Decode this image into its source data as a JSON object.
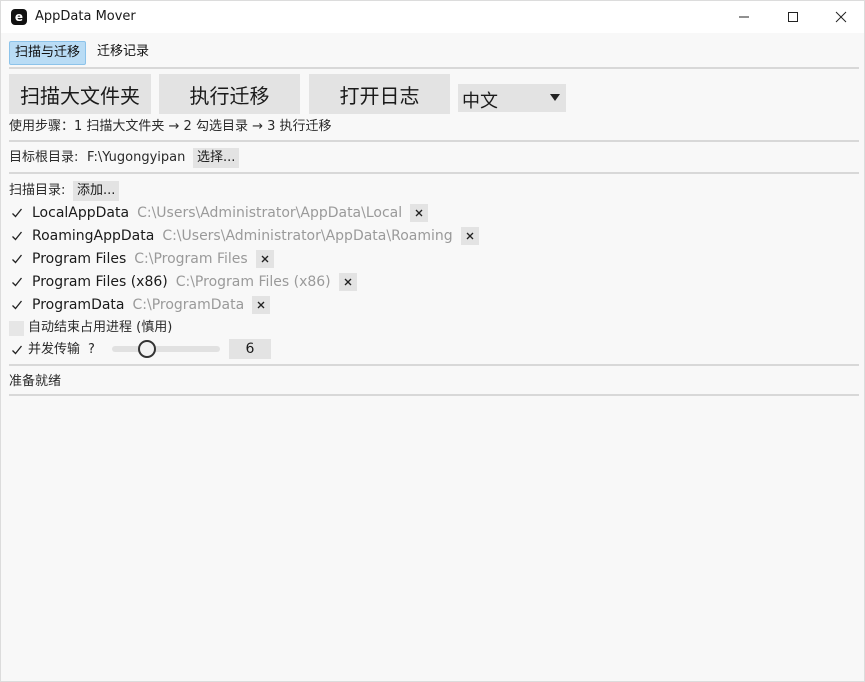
{
  "window": {
    "title": "AppData Mover",
    "icon_letter": "e"
  },
  "tabs": [
    {
      "label": "扫描与迁移",
      "active": true
    },
    {
      "label": "迁移记录",
      "active": false
    }
  ],
  "toolbar": {
    "scan_label": "扫描大文件夹",
    "migrate_label": "执行迁移",
    "log_label": "打开日志",
    "language_value": "中文"
  },
  "steps_text": "使用步骤：1 扫描大文件夹 → 2 勾选目录 → 3 执行迁移",
  "target": {
    "label": "目标根目录:",
    "path": "F:\\Yugongyipan",
    "choose_label": "选择..."
  },
  "scan": {
    "label": "扫描目录:",
    "add_label": "添加...",
    "items": [
      {
        "name": "LocalAppData",
        "path": "C:\\Users\\Administrator\\AppData\\Local",
        "checked": true
      },
      {
        "name": "RoamingAppData",
        "path": "C:\\Users\\Administrator\\AppData\\Roaming",
        "checked": true
      },
      {
        "name": "Program Files",
        "path": "C:\\Program Files",
        "checked": true
      },
      {
        "name": "Program Files (x86)",
        "path": "C:\\Program Files (x86)",
        "checked": true
      },
      {
        "name": "ProgramData",
        "path": "C:\\ProgramData",
        "checked": true
      }
    ]
  },
  "options": {
    "auto_kill_label": "自动结束占用进程 (慎用)",
    "auto_kill_checked": false,
    "concurrent_label": "并发传输",
    "concurrent_help": "?",
    "concurrent_checked": true,
    "concurrency": 6,
    "concurrency_fraction": 0.33
  },
  "status": "准备就绪"
}
